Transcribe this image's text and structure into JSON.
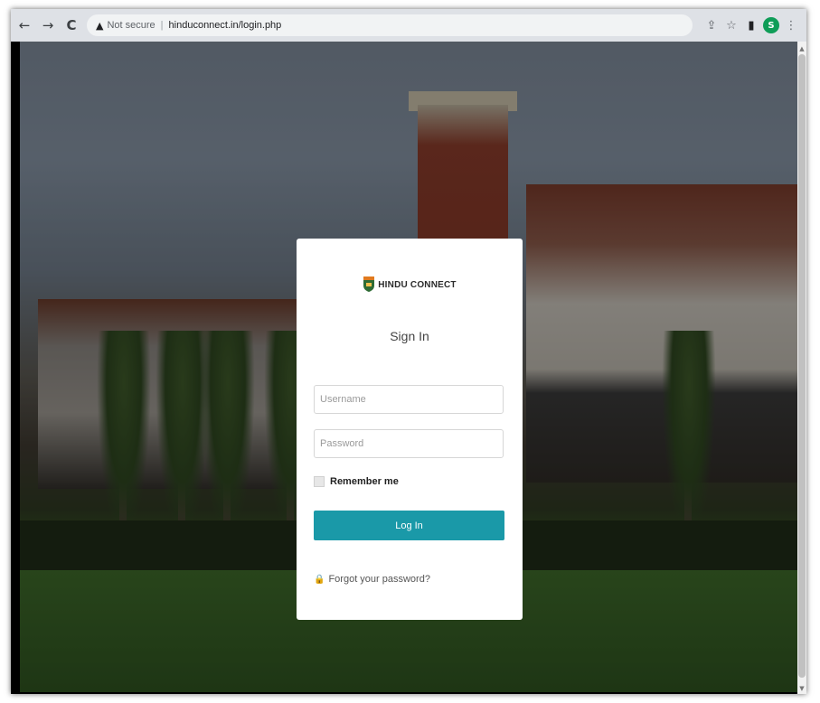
{
  "browser": {
    "back_icon": "←",
    "forward_icon": "→",
    "reload_icon": "C",
    "warning_icon": "▲",
    "not_secure": "Not secure",
    "separator": "|",
    "url": "hinduconnect.in/login.php",
    "share_icon": "⇪",
    "star_icon": "☆",
    "panel_icon": "▮",
    "profile_initial": "S",
    "menu_icon": "⋮"
  },
  "login": {
    "brand": "HINDU CONNECT",
    "title": "Sign In",
    "username_placeholder": "Username",
    "password_placeholder": "Password",
    "remember_label": "Remember me",
    "button_label": "Log In",
    "lock_icon": "🔒",
    "forgot_label": "Forgot your password?"
  },
  "colors": {
    "primary_button": "#1a99a8",
    "profile_badge": "#0f9d58"
  }
}
